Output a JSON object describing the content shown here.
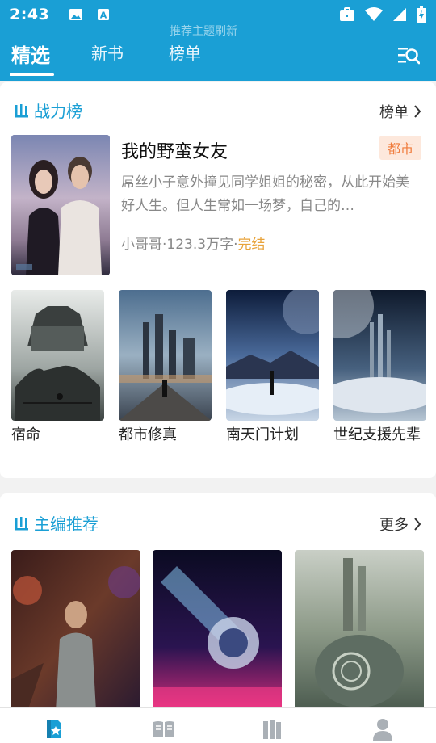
{
  "status_bar": {
    "time": "2:43",
    "left_icons": [
      "image-icon",
      "text-notification-icon"
    ],
    "right_icons": [
      "briefcase-icon",
      "wifi-icon",
      "signal-icon",
      "battery-charging-icon"
    ]
  },
  "header": {
    "ghost_text": "推荐主题刷新",
    "tabs": [
      {
        "label": "精选",
        "active": true
      },
      {
        "label": "新书",
        "active": false
      },
      {
        "label": "榜单",
        "active": false
      }
    ],
    "search_icon": "search-list-icon"
  },
  "ranking_section": {
    "title": "战力榜",
    "more_label": "榜单",
    "featured": {
      "title": "我的野蛮女友",
      "genre": "都市",
      "description": "屌丝小子意外撞见同学姐姐的秘密，从此开始美好人生。但人生常如一场梦，自己的…",
      "author": "小哥哥",
      "sep1": "·",
      "words": "123.3万字",
      "sep2": "·",
      "status": "完结"
    },
    "books": [
      {
        "title": "宿命"
      },
      {
        "title": "都市修真"
      },
      {
        "title": "南天门计划"
      },
      {
        "title": "世纪支援先辈"
      }
    ]
  },
  "editor_section": {
    "title": "主编推荐",
    "more_label": "更多"
  },
  "bottom_nav": {
    "items": [
      "featured-book-icon",
      "open-book-icon",
      "bookshelf-icon",
      "profile-icon"
    ],
    "active_color": "#1a9fd5",
    "inactive_color": "#aab0b6"
  },
  "colors": {
    "brand": "#1a9fd5",
    "tag_text": "#f07a3a",
    "tag_bg": "#fde8dc",
    "status_done": "#e8a33a"
  }
}
